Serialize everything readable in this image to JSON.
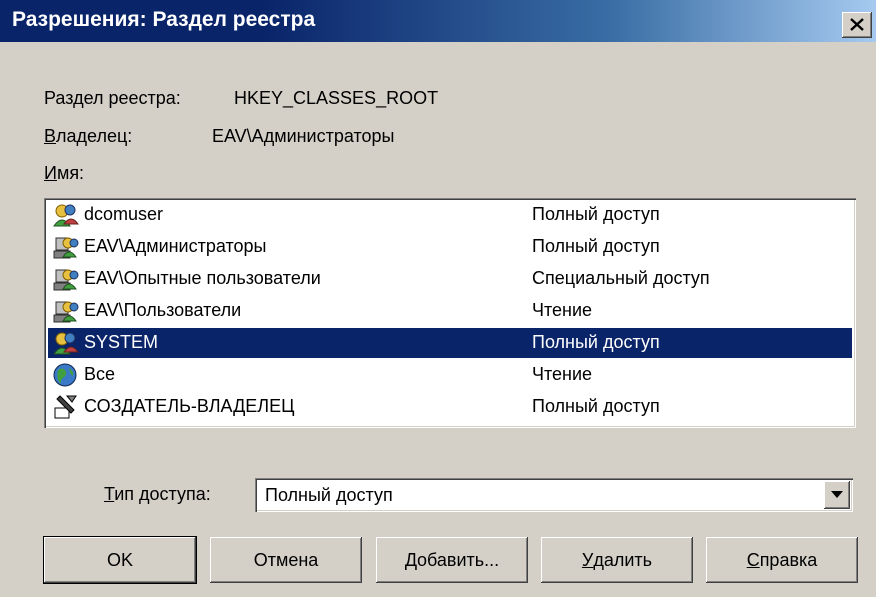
{
  "window": {
    "title": "Разрешения: Раздел реестра"
  },
  "info": {
    "key_label": "Раздел реестра:",
    "key_value": "HKEY_CLASSES_ROOT",
    "owner_label": "Владелец:",
    "owner_value": "EAV\\Администраторы",
    "name_label": "Имя:"
  },
  "principals": [
    {
      "name": "dcomuser",
      "access": "Полный доступ",
      "icon": "user-icon",
      "selected": false
    },
    {
      "name": "EAV\\Администраторы",
      "access": "Полный доступ",
      "icon": "group-icon",
      "selected": false
    },
    {
      "name": "EAV\\Опытные пользователи",
      "access": "Специальный доступ",
      "icon": "group-icon",
      "selected": false
    },
    {
      "name": "EAV\\Пользователи",
      "access": "Чтение",
      "icon": "group-icon",
      "selected": false
    },
    {
      "name": "SYSTEM",
      "access": "Полный доступ",
      "icon": "user-icon",
      "selected": true
    },
    {
      "name": "Все",
      "access": "Чтение",
      "icon": "globe-icon",
      "selected": false
    },
    {
      "name": "СОЗДАТЕЛЬ-ВЛАДЕЛЕЦ",
      "access": "Полный доступ",
      "icon": "creator-owner-icon",
      "selected": false
    }
  ],
  "access_type": {
    "label": "Тип доступа:",
    "value": "Полный доступ"
  },
  "buttons": {
    "ok": "OK",
    "cancel": "Отмена",
    "add": "Добавить...",
    "remove": "Удалить",
    "help": "Справка"
  },
  "colors": {
    "selection": "#0a246a",
    "face": "#d4d0c8"
  }
}
